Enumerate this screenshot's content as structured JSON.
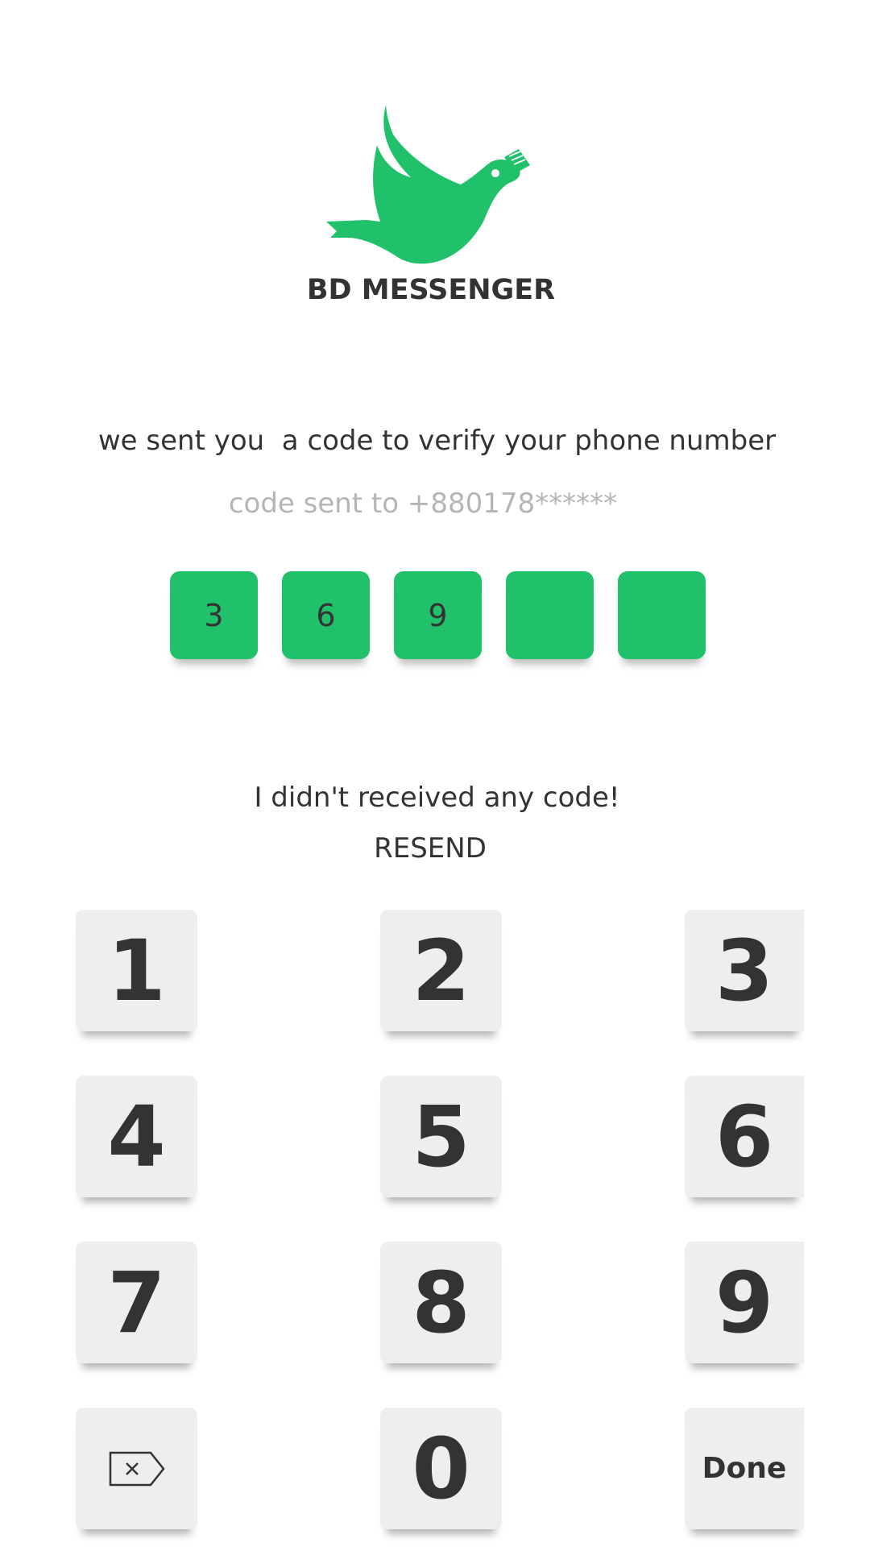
{
  "app": {
    "name": "BD MESSENGER",
    "logo_icon": "dove-with-letter-icon",
    "brand_color": "#21c16b"
  },
  "verification": {
    "message": "we sent you  a code to verify your phone number",
    "sent_to": "code sent to +880178******",
    "code_digits": [
      "3",
      "6",
      "9",
      "",
      ""
    ]
  },
  "resend": {
    "prompt": "I didn't received any code!",
    "label": "RESEND"
  },
  "keypad": {
    "keys": [
      "1",
      "2",
      "3",
      "4",
      "5",
      "6",
      "7",
      "8",
      "9",
      "",
      "0",
      "Done"
    ],
    "backspace_icon": "backspace-icon",
    "key_background": "#eeeeee"
  }
}
